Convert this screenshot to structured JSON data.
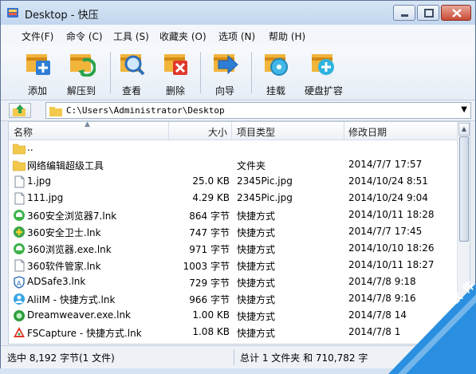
{
  "window": {
    "title": "Desktop - 快压"
  },
  "menu": [
    "文件(F)",
    "命令 (C)",
    "工具 (S)",
    "收藏夹 (O)",
    "选项 (N)",
    "帮助 (H)"
  ],
  "toolbar": {
    "add": "添加",
    "extract": "解压到",
    "view": "查看",
    "delete": "删除",
    "wizard": "向导",
    "mount": "挂载",
    "disk": "硬盘扩容"
  },
  "address": {
    "path": "C:\\Users\\Administrator\\Desktop"
  },
  "columns": {
    "name": "名称",
    "size": "大小",
    "type": "项目类型",
    "date": "修改日期"
  },
  "rows": [
    {
      "name": "..",
      "size": "",
      "type": "",
      "date": "",
      "icon": "folder-icon"
    },
    {
      "name": "网络编辑超级工具",
      "size": "",
      "type": "文件夹",
      "date": "2014/7/7 17:57",
      "icon": "folder-icon"
    },
    {
      "name": "1.jpg",
      "size": "25.0 KB",
      "type": "2345Pic.jpg",
      "date": "2014/10/24 8:51",
      "icon": "file-icon"
    },
    {
      "name": "111.jpg",
      "size": "4.29 KB",
      "type": "2345Pic.jpg",
      "date": "2014/10/24 9:04",
      "icon": "file-icon"
    },
    {
      "name": "360安全浏览器7.lnk",
      "size": "864 字节",
      "type": "快捷方式",
      "date": "2014/10/11 18:28",
      "icon": "browser-green-icon"
    },
    {
      "name": "360安全卫士.lnk",
      "size": "747 字节",
      "type": "快捷方式",
      "date": "2014/7/7 17:45",
      "icon": "shield-plus-icon"
    },
    {
      "name": "360浏览器.exe.lnk",
      "size": "971 字节",
      "type": "快捷方式",
      "date": "2014/10/10 18:26",
      "icon": "browser-green-icon"
    },
    {
      "name": "360软件管家.lnk",
      "size": "1003 字节",
      "type": "快捷方式",
      "date": "2014/10/11 18:27",
      "icon": "file-icon"
    },
    {
      "name": "ADSafe3.lnk",
      "size": "729 字节",
      "type": "快捷方式",
      "date": "2014/7/8 9:18",
      "icon": "shield-blue-icon"
    },
    {
      "name": "AliIM - 快捷方式.lnk",
      "size": "966 字节",
      "type": "快捷方式",
      "date": "2014/7/8 9:16",
      "icon": "person-icon"
    },
    {
      "name": "Dreamweaver.exe.lnk",
      "size": "1.00 KB",
      "type": "快捷方式",
      "date": "2014/7/8 14",
      "icon": "green-circle-icon"
    },
    {
      "name": "FSCapture - 快捷方式.lnk",
      "size": "1.08 KB",
      "type": "快捷方式",
      "date": "2014/7/8 1",
      "icon": "capture-icon"
    }
  ],
  "status": {
    "left": "选中 8,192 字节(1 文件)",
    "right": "总计 1 文件夹 和 710,782 字"
  },
  "watermark": {
    "text": "河 东 软 件"
  },
  "colors": {
    "accent": "#e8412c",
    "folder": "#f2c94c",
    "selection": "#cfe3fb"
  }
}
